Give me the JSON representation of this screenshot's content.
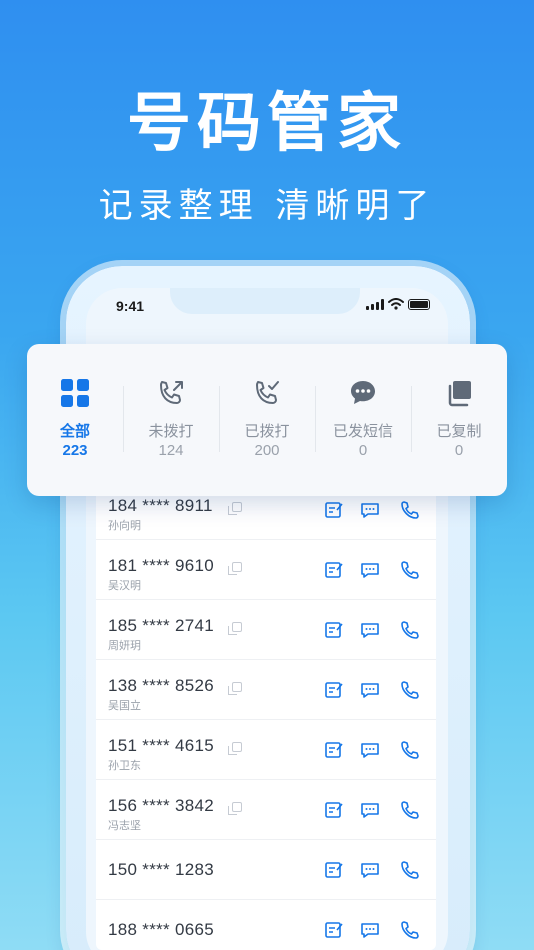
{
  "hero": {
    "title": "号码管家",
    "subtitle": "记录整理 清晰明了"
  },
  "status_bar": {
    "time": "9:41"
  },
  "tabs": [
    {
      "label": "全部",
      "count": "223",
      "icon": "grid-icon",
      "active": true
    },
    {
      "label": "未拨打",
      "count": "124",
      "icon": "outgoing-call-icon",
      "active": false
    },
    {
      "label": "已拨打",
      "count": "200",
      "icon": "call-checked-icon",
      "active": false
    },
    {
      "label": "已发短信",
      "count": "0",
      "icon": "message-bubble-icon",
      "active": false
    },
    {
      "label": "已复制",
      "count": "0",
      "icon": "copy-icon",
      "active": false
    }
  ],
  "contacts": [
    {
      "number": "184 **** 8911",
      "name": "孙向明"
    },
    {
      "number": "181 **** 9610",
      "name": "吴汉明"
    },
    {
      "number": "185 **** 2741",
      "name": "周妍玥"
    },
    {
      "number": "138 **** 8526",
      "name": "吴国立"
    },
    {
      "number": "151 **** 4615",
      "name": "孙卫东"
    },
    {
      "number": "156 **** 3842",
      "name": "冯志坚"
    },
    {
      "number": "150 **** 1283",
      "name": ""
    },
    {
      "number": "188 **** 0665",
      "name": ""
    }
  ],
  "colors": {
    "accent": "#1677e8",
    "icon_inactive": "#8a929e",
    "action_icon": "#1677e8"
  }
}
